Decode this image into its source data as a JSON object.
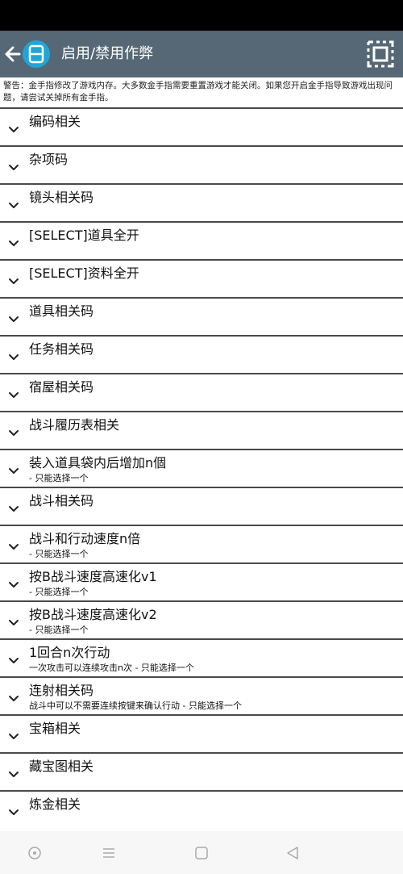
{
  "app_bar": {
    "title": "启用/禁用作弊",
    "back_icon": "arrow-left-icon",
    "logo_icon": "app-logo-icon",
    "select_all_icon": "select-all-icon",
    "color": "#566875"
  },
  "warning": "警告：金手指修改了游戏内存。大多数金手指需要重置游戏才能关闭。如果您开启金手指导致游戏出现问题，请尝试关掉所有金手指。",
  "cheats": [
    {
      "label": "编码相关",
      "desc": ""
    },
    {
      "label": "杂项码",
      "desc": ""
    },
    {
      "label": "镜头相关码",
      "desc": ""
    },
    {
      "label": "[SELECT]道具全开",
      "desc": ""
    },
    {
      "label": "[SELECT]资料全开",
      "desc": ""
    },
    {
      "label": "道具相关码",
      "desc": ""
    },
    {
      "label": "任务相关码",
      "desc": ""
    },
    {
      "label": "宿屋相关码",
      "desc": ""
    },
    {
      "label": "战斗履历表相关",
      "desc": ""
    },
    {
      "label": "装入道具袋内后增加n個",
      "desc": "- 只能选择一个"
    },
    {
      "label": "战斗相关码",
      "desc": ""
    },
    {
      "label": "战斗和行动速度n倍",
      "desc": "- 只能选择一个"
    },
    {
      "label": "按B战斗速度高速化v1",
      "desc": "- 只能选择一个"
    },
    {
      "label": "按B战斗速度高速化v2",
      "desc": "- 只能选择一个"
    },
    {
      "label": "1回合n次行动",
      "desc": "一次攻击可以连续攻击n次 - 只能选择一个"
    },
    {
      "label": "连射相关码",
      "desc": "战斗中可以不需要连续按键来确认行动 - 只能选择一个"
    },
    {
      "label": "宝箱相关",
      "desc": ""
    },
    {
      "label": "藏宝图相关",
      "desc": ""
    },
    {
      "label": "炼金相关",
      "desc": ""
    }
  ],
  "nav": {
    "assistant_icon": "assistant-icon",
    "menu_icon": "menu-icon",
    "home_icon": "home-square-icon",
    "back_icon": "back-triangle-icon"
  }
}
